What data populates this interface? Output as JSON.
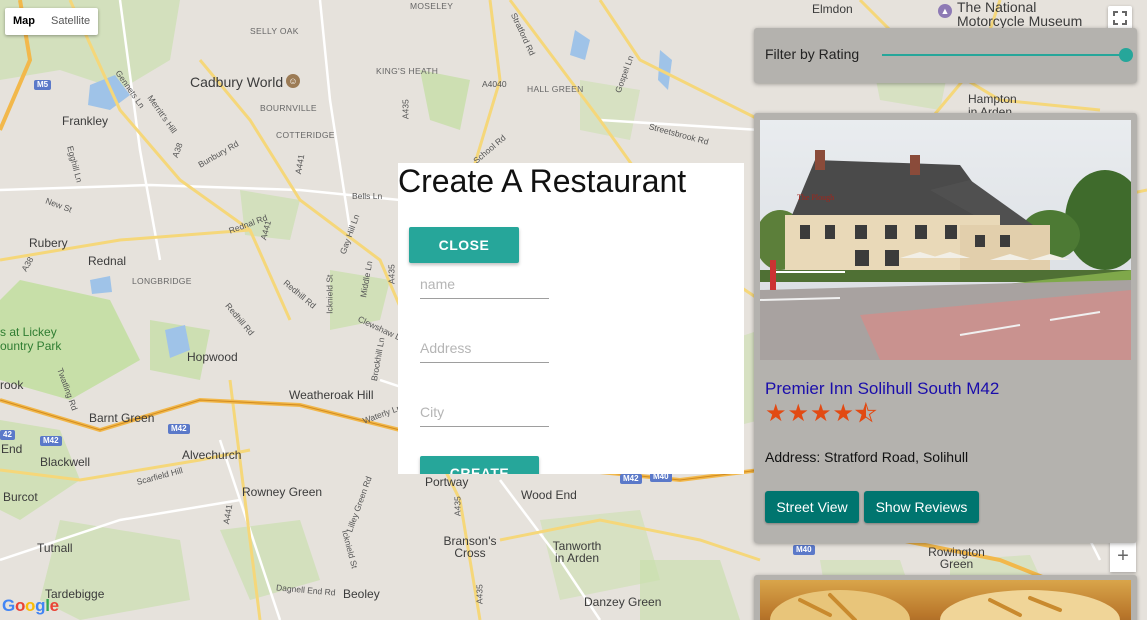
{
  "map": {
    "type_buttons": [
      "Map",
      "Satellite"
    ],
    "active_type": "Map",
    "labels": {
      "towns": [
        "Frankley",
        "Rubery",
        "Rednal",
        "Hopwood",
        "Barnt Green",
        "Alvechurch",
        "Blackwell",
        "Burcot",
        "Tutnall",
        "Tardebigge",
        "Rowney Green",
        "Weatheroak Hill",
        "Portway",
        "Wood End",
        "Branson's Cross",
        "Tanworth in Arden",
        "Danzey Green",
        "Beoley",
        "End",
        "Elmdon",
        "Rowington Green",
        "rook"
      ],
      "big": [
        "Cadbury World",
        "The National Motorcycle Museum",
        "Hampton in Arden"
      ],
      "areas": [
        "SELLY OAK",
        "MOSELEY",
        "KING'S HEATH",
        "BOURNVILLE",
        "COTTERIDGE",
        "HALL GREEN",
        "LONGBRIDGE"
      ],
      "park": [
        "s at Lickey",
        "ountry Park"
      ],
      "roads": [
        "Stratford Rd",
        "Gennets Ln",
        "Merritt's Hill",
        "Egghill Ln",
        "New St",
        "A38",
        "A38",
        "Bunbury Rd",
        "Redhill Rd",
        "Rednal Rd",
        "A441",
        "A441",
        "A435",
        "A435",
        "A435",
        "A4040",
        "Bells Ln",
        "Gay Hill Ln",
        "Icknield St",
        "Middle Ln",
        "Clewshaw Ln",
        "Brockhill Ln",
        "Waterly Ln",
        "Twatling Rd",
        "Redhill Rd",
        "Scarfield Hill",
        "Lilley Green Rd",
        "Icknield St",
        "Dagnell End Rd",
        "School Rd",
        "Streetsbrook Rd",
        "Gospel Ln",
        "A441",
        "A435"
      ],
      "shields": [
        "M5",
        "M42",
        "M42",
        "M42",
        "M42",
        "M40",
        "M40",
        "42"
      ]
    },
    "google_logo": "Google"
  },
  "modal": {
    "title": "Create A Restaurant",
    "close_label": "CLOSE",
    "fields": [
      {
        "placeholder": "name",
        "value": ""
      },
      {
        "placeholder": "Address",
        "value": ""
      },
      {
        "placeholder": "City",
        "value": ""
      }
    ],
    "create_label": "CREATE"
  },
  "filter": {
    "label": "Filter by Rating",
    "value_fraction": 1.0,
    "accent_color": "#26a69a"
  },
  "restaurants": [
    {
      "name": "Premier Inn Solihull South M42",
      "rating": 4.5,
      "address": "Address: Stratford Road, Solihull",
      "buttons": [
        "Street View",
        "Show Reviews"
      ],
      "photo_sign": "The Plough"
    }
  ],
  "colors": {
    "star": "#e24a13",
    "button_teal": "#26a69a",
    "card_button": "#00756f",
    "link": "#1a0dab",
    "card_bg": "#b4b2ae"
  }
}
